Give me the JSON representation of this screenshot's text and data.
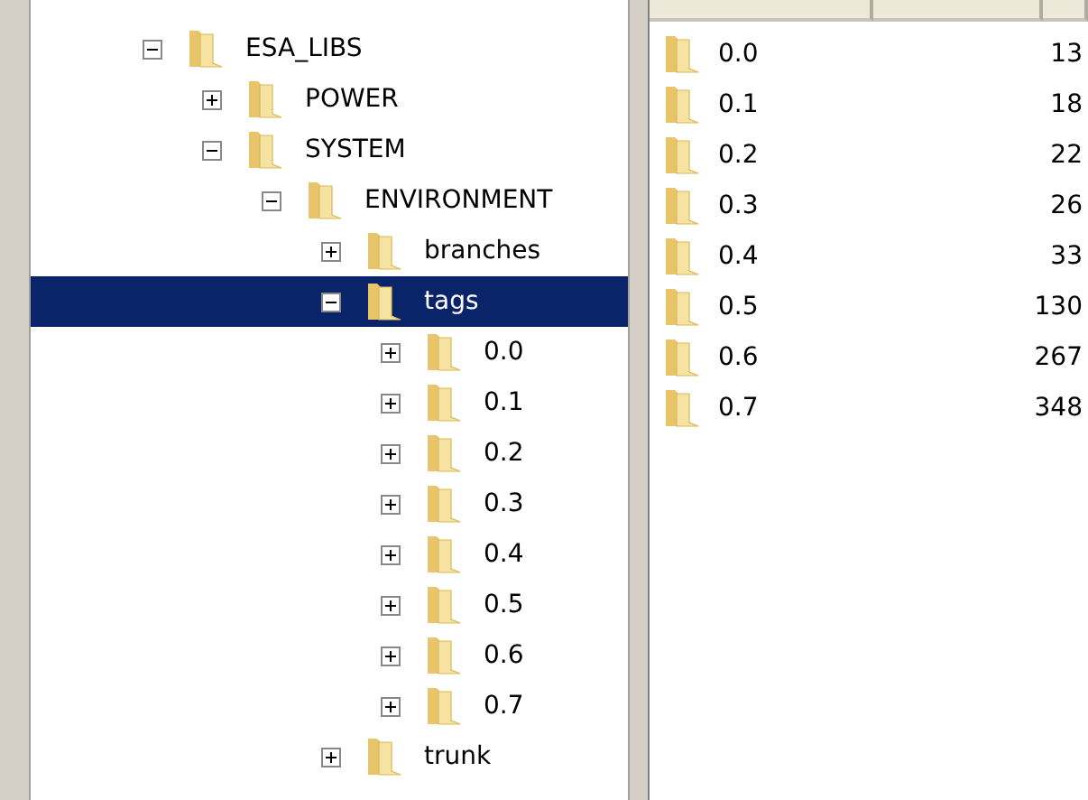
{
  "tree": [
    {
      "label": "ESA_LIBS",
      "expanded": true,
      "selected": false,
      "children": [
        {
          "label": "POWER",
          "expanded": false,
          "selected": false
        },
        {
          "label": "SYSTEM",
          "expanded": true,
          "selected": false,
          "children": [
            {
              "label": "ENVIRONMENT",
              "expanded": true,
              "selected": false,
              "children": [
                {
                  "label": "branches",
                  "expanded": false,
                  "selected": false
                },
                {
                  "label": "tags",
                  "expanded": true,
                  "selected": true,
                  "children": [
                    {
                      "label": "0.0",
                      "expanded": false,
                      "selected": false
                    },
                    {
                      "label": "0.1",
                      "expanded": false,
                      "selected": false
                    },
                    {
                      "label": "0.2",
                      "expanded": false,
                      "selected": false
                    },
                    {
                      "label": "0.3",
                      "expanded": false,
                      "selected": false
                    },
                    {
                      "label": "0.4",
                      "expanded": false,
                      "selected": false
                    },
                    {
                      "label": "0.5",
                      "expanded": false,
                      "selected": false
                    },
                    {
                      "label": "0.6",
                      "expanded": false,
                      "selected": false
                    },
                    {
                      "label": "0.7",
                      "expanded": false,
                      "selected": false
                    }
                  ]
                },
                {
                  "label": "trunk",
                  "expanded": false,
                  "selected": false
                }
              ]
            }
          ]
        }
      ]
    }
  ],
  "list": [
    {
      "name": "0.0",
      "value": "13"
    },
    {
      "name": "0.1",
      "value": "18"
    },
    {
      "name": "0.2",
      "value": "22"
    },
    {
      "name": "0.3",
      "value": "26"
    },
    {
      "name": "0.4",
      "value": "33"
    },
    {
      "name": "0.5",
      "value": "130"
    },
    {
      "name": "0.6",
      "value": "267"
    },
    {
      "name": "0.7",
      "value": "348"
    }
  ]
}
